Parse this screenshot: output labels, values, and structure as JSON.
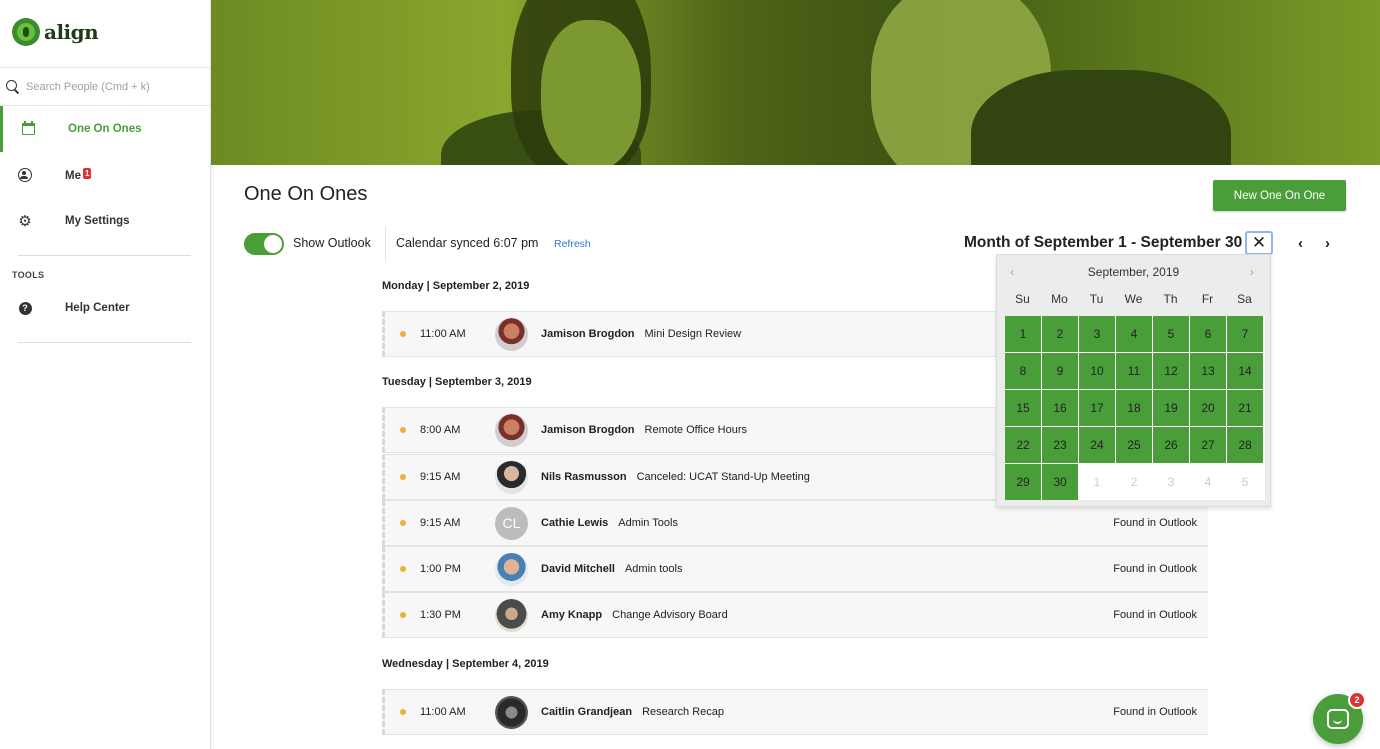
{
  "app": {
    "logo_text": "align"
  },
  "search": {
    "placeholder": "Search People (Cmd + k)"
  },
  "sidebar": {
    "items": [
      {
        "label": "One On Ones",
        "icon": "calendar-icon",
        "active": true
      },
      {
        "label": "Me",
        "icon": "user-circle-icon",
        "badge": "1"
      },
      {
        "label": "My Settings",
        "icon": "gear-icon"
      }
    ],
    "tools_label": "TOOLS",
    "tools": [
      {
        "label": "Help Center",
        "icon": "help-icon"
      }
    ]
  },
  "header": {
    "title": "One On Ones",
    "new_button": "New One On One",
    "show_outlook": "Show Outlook",
    "synced": "Calendar synced 6:07 pm",
    "refresh": "Refresh",
    "month_title": "Month of September 1 - September 30",
    "close_symbol": "✕",
    "prev_symbol": "‹",
    "next_symbol": "›"
  },
  "days": [
    {
      "label": "Monday | September 2, 2019",
      "meetings": [
        {
          "time": "11:00 AM",
          "person": "Jamison Brogdon",
          "title": "Mini Design Review",
          "found": "",
          "avatar": "photo"
        }
      ]
    },
    {
      "label": "Tuesday | September 3, 2019",
      "meetings": [
        {
          "time": "8:00 AM",
          "person": "Jamison Brogdon",
          "title": "Remote Office Hours",
          "found": "",
          "avatar": "photo"
        },
        {
          "time": "9:15 AM",
          "person": "Nils Rasmusson",
          "title": "Canceled: UCAT Stand-Up Meeting",
          "found": "",
          "avatar": "photo"
        },
        {
          "time": "9:15 AM",
          "person": "Cathie Lewis",
          "title": "Admin Tools",
          "found": "Found in Outlook",
          "avatar": "CL"
        },
        {
          "time": "1:00 PM",
          "person": "David Mitchell",
          "title": "Admin tools",
          "found": "Found in Outlook",
          "avatar": "photo"
        },
        {
          "time": "1:30 PM",
          "person": "Amy Knapp",
          "title": "Change Advisory Board",
          "found": "Found in Outlook",
          "avatar": "photo"
        }
      ]
    },
    {
      "label": "Wednesday | September 4, 2019",
      "meetings": [
        {
          "time": "11:00 AM",
          "person": "Caitlin Grandjean",
          "title": "Research Recap",
          "found": "Found in Outlook",
          "avatar": "photo"
        }
      ]
    }
  ],
  "datepicker": {
    "month_label": "September, 2019",
    "prev_symbol": "‹",
    "next_symbol": "›",
    "weekdays": [
      "Su",
      "Mo",
      "Tu",
      "We",
      "Th",
      "Fr",
      "Sa"
    ],
    "cells": [
      {
        "d": "1",
        "in": true
      },
      {
        "d": "2",
        "in": true
      },
      {
        "d": "3",
        "in": true
      },
      {
        "d": "4",
        "in": true
      },
      {
        "d": "5",
        "in": true
      },
      {
        "d": "6",
        "in": true
      },
      {
        "d": "7",
        "in": true
      },
      {
        "d": "8",
        "in": true
      },
      {
        "d": "9",
        "in": true
      },
      {
        "d": "10",
        "in": true
      },
      {
        "d": "11",
        "in": true
      },
      {
        "d": "12",
        "in": true
      },
      {
        "d": "13",
        "in": true
      },
      {
        "d": "14",
        "in": true
      },
      {
        "d": "15",
        "in": true
      },
      {
        "d": "16",
        "in": true
      },
      {
        "d": "17",
        "in": true
      },
      {
        "d": "18",
        "in": true
      },
      {
        "d": "19",
        "in": true
      },
      {
        "d": "20",
        "in": true
      },
      {
        "d": "21",
        "in": true
      },
      {
        "d": "22",
        "in": true
      },
      {
        "d": "23",
        "in": true
      },
      {
        "d": "24",
        "in": true
      },
      {
        "d": "25",
        "in": true
      },
      {
        "d": "26",
        "in": true
      },
      {
        "d": "27",
        "in": true
      },
      {
        "d": "28",
        "in": true
      },
      {
        "d": "29",
        "in": true
      },
      {
        "d": "30",
        "in": true
      },
      {
        "d": "1",
        "in": false
      },
      {
        "d": "2",
        "in": false
      },
      {
        "d": "3",
        "in": false
      },
      {
        "d": "4",
        "in": false
      },
      {
        "d": "5",
        "in": false
      }
    ]
  },
  "chat": {
    "badge": "2"
  },
  "colors": {
    "accent": "#4a9e3a",
    "dot": "#e8b33a",
    "link": "#2a7bd6",
    "badge": "#dd3333"
  }
}
